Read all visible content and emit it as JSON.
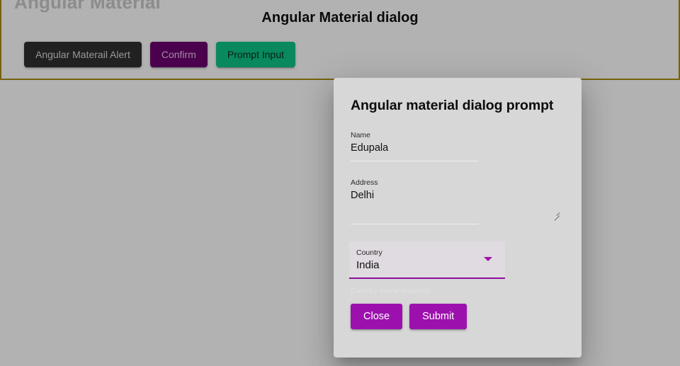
{
  "page": {
    "ghost_heading": "Angular Material",
    "title": "Angular Material dialog",
    "toolbar": {
      "buttons": [
        {
          "label": "Angular Materail Alert",
          "color": "#303030",
          "name": "alert"
        },
        {
          "label": "Confirm",
          "color": "#6a006f",
          "name": "confirm"
        },
        {
          "label": "Prompt Input",
          "color": "#0ec486",
          "name": "prompt"
        }
      ],
      "border_color": "#a98f12"
    }
  },
  "dialog": {
    "title": "Angular material dialog prompt",
    "fields": {
      "name": {
        "label": "Name",
        "value": "Edupala",
        "placeholder": "Name"
      },
      "address": {
        "label": "Address",
        "value": "Delhi",
        "placeholder": "Address"
      },
      "country": {
        "label": "Country",
        "value": "India",
        "placeholder": "Country",
        "hint": "Country name required",
        "options": [
          "India"
        ],
        "accent": "#9b13ab"
      }
    },
    "actions": {
      "close_label": "Close",
      "submit_label": "Submit",
      "button_color": "#9c11ad"
    }
  }
}
